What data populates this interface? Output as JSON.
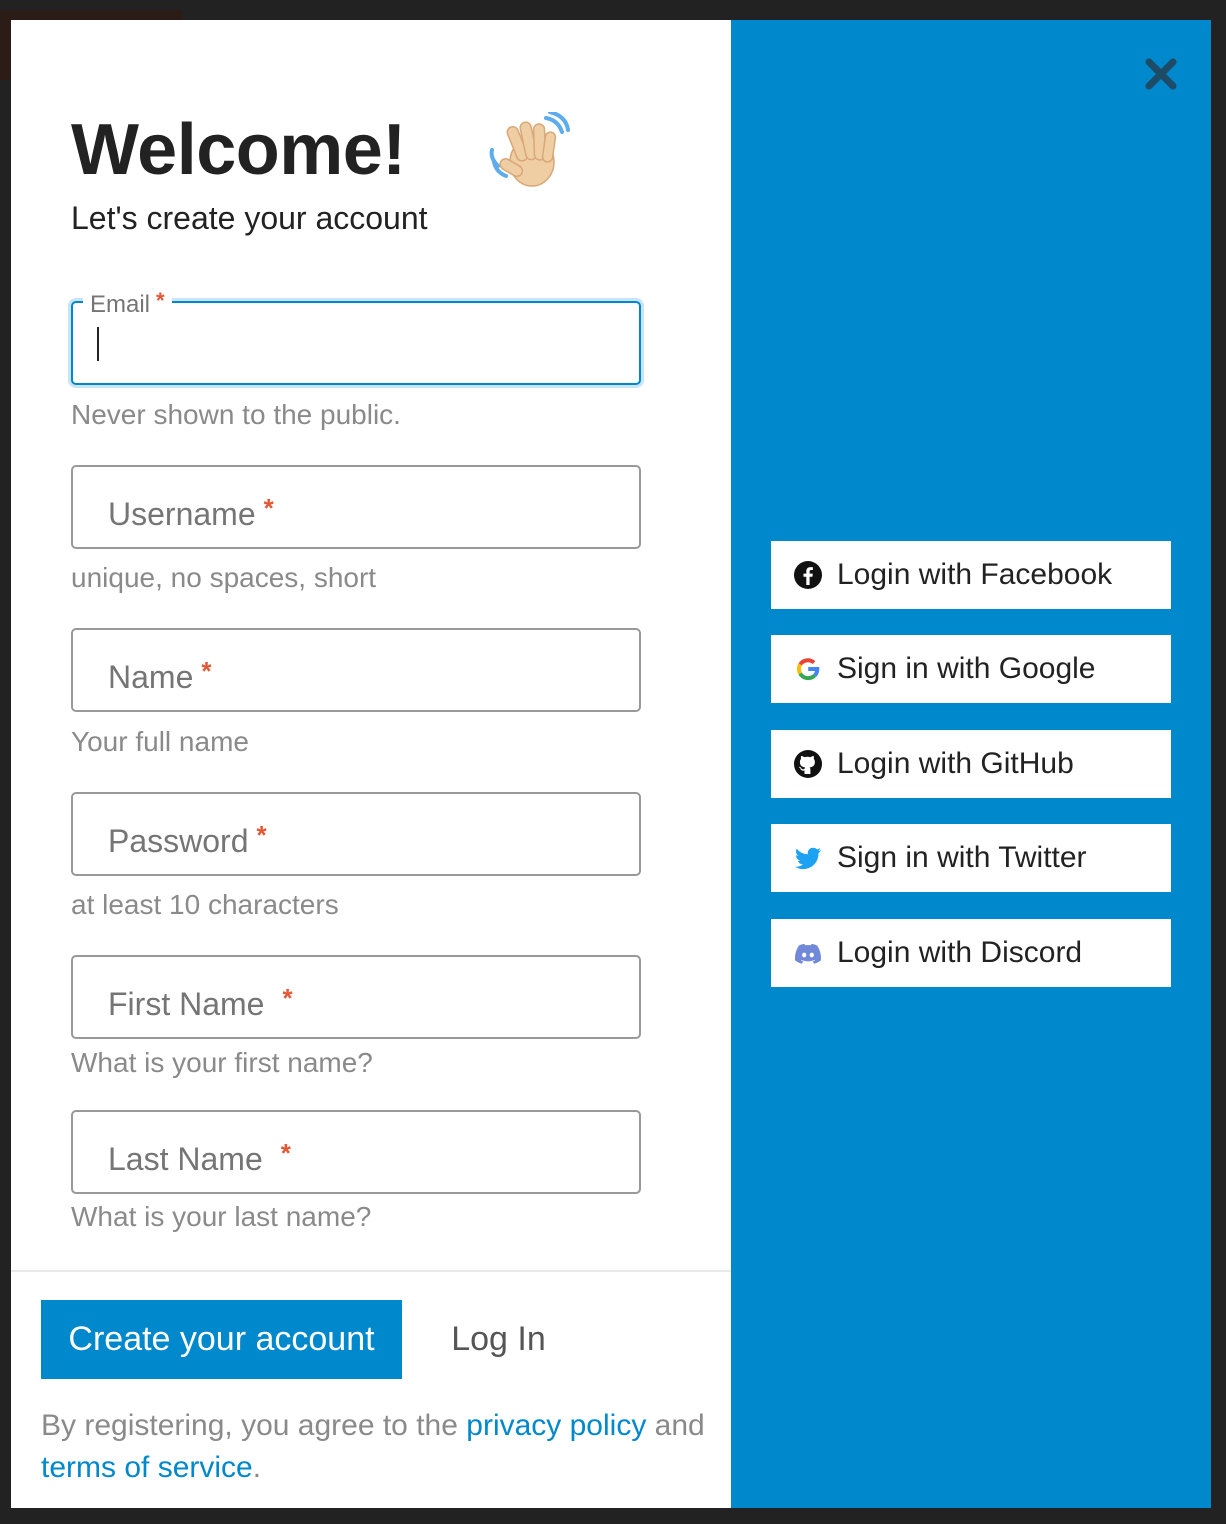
{
  "header": {
    "title": "Welcome!",
    "subtitle": "Let's create your account"
  },
  "form": {
    "required_marker": "*",
    "email": {
      "label": "Email",
      "value": "",
      "hint": "Never shown to the public."
    },
    "username": {
      "placeholder": "Username",
      "hint": "unique, no spaces, short"
    },
    "name": {
      "placeholder": "Name",
      "hint": "Your full name"
    },
    "password": {
      "placeholder": "Password",
      "hint": "at least 10 characters"
    },
    "first_name": {
      "placeholder": "First Name",
      "hint": "What is your first name?"
    },
    "last_name": {
      "placeholder": "Last Name",
      "hint": "What is your last name?"
    }
  },
  "footer": {
    "create_label": "Create your account",
    "login_label": "Log In",
    "legal_prefix": "By registering, you agree to the",
    "privacy_link": "privacy policy",
    "legal_and": "and",
    "terms_link": "terms of service",
    "legal_end": "."
  },
  "social": {
    "buttons": [
      {
        "label": "Login with Facebook",
        "icon": "facebook-icon"
      },
      {
        "label": "Sign in with Google",
        "icon": "google-icon"
      },
      {
        "label": "Login with GitHub",
        "icon": "github-icon"
      },
      {
        "label": "Sign in with Twitter",
        "icon": "twitter-icon"
      },
      {
        "label": "Login with Discord",
        "icon": "discord-icon"
      }
    ]
  },
  "colors": {
    "accent": "#0088cc",
    "required": "#e45735",
    "backdrop": "#222222",
    "twitter": "#1da1f2",
    "discord": "#7289da"
  }
}
